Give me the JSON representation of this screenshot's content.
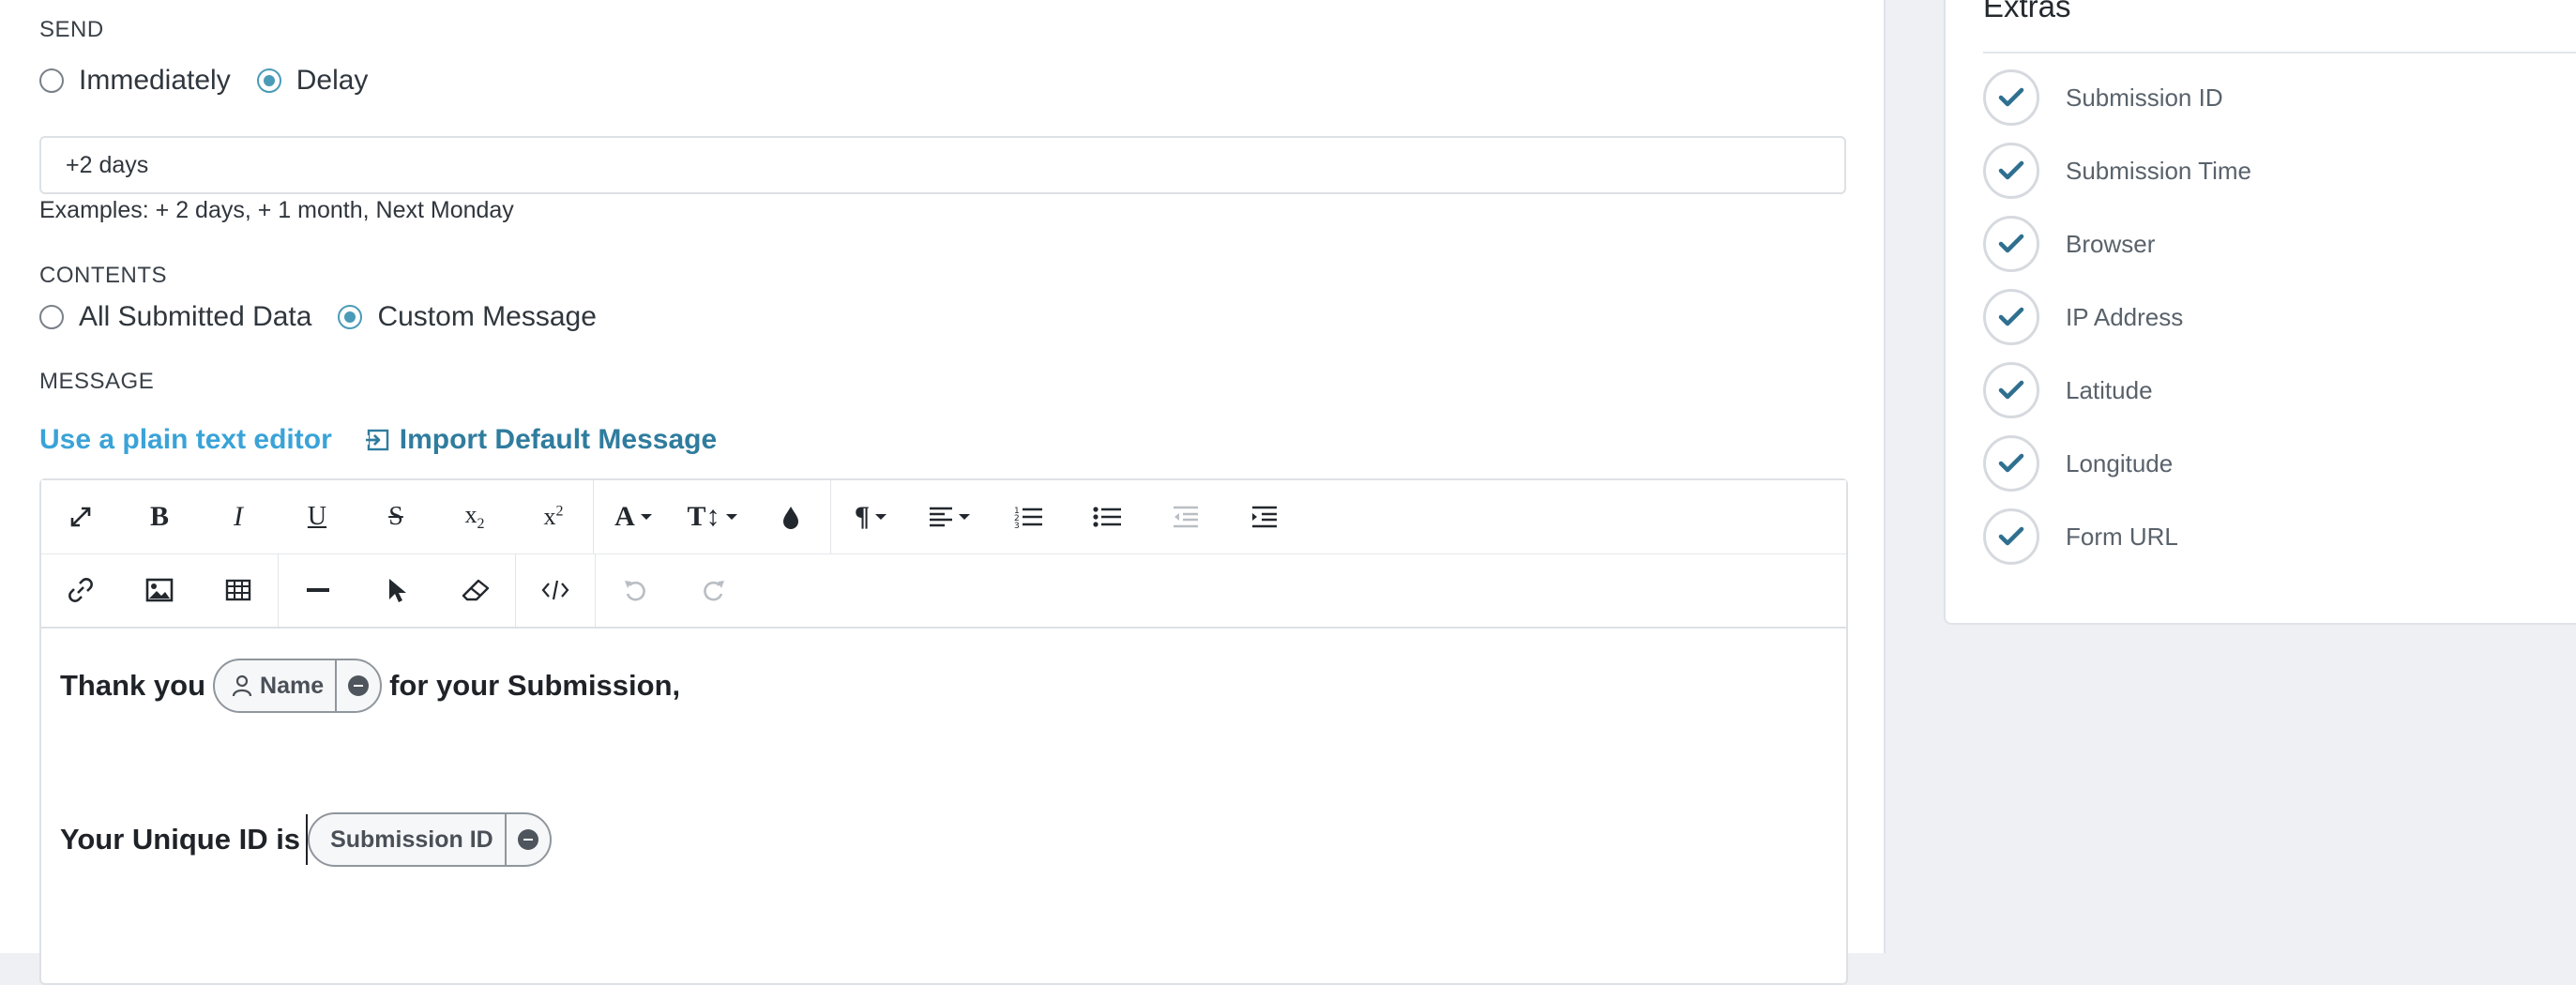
{
  "send": {
    "label": "SEND",
    "options": [
      "Immediately",
      "Delay"
    ],
    "selected": "Delay"
  },
  "delay": {
    "value": "+2 days",
    "hint": "Examples: + 2 days, + 1 month, Next Monday"
  },
  "contents": {
    "label": "CONTENTS",
    "options": [
      "All Submitted Data",
      "Custom Message"
    ],
    "selected": "Custom Message"
  },
  "message": {
    "label": "MESSAGE",
    "plain_editor_link": "Use a plain text editor",
    "import_link": "Import Default Message"
  },
  "toolbar": {
    "row1": [
      "fullscreen-icon",
      "bold-icon",
      "italic-icon",
      "underline-icon",
      "strikethrough-icon",
      "subscript-icon",
      "superscript-icon",
      "font-family-icon",
      "font-size-icon",
      "text-color-icon",
      "paragraph-format-icon",
      "align-icon",
      "ordered-list-icon",
      "unordered-list-icon",
      "outdent-icon",
      "indent-icon"
    ],
    "row2": [
      "insert-link-icon",
      "insert-image-icon",
      "insert-table-icon",
      "horizontal-line-icon",
      "select-all-icon",
      "clear-formatting-icon",
      "code-view-icon",
      "undo-icon",
      "redo-icon"
    ]
  },
  "editor_content": {
    "line1_before": "Thank you",
    "line1_tag": "Name",
    "line1_after": "for your Submission,",
    "line2_before": "Your Unique ID is",
    "line2_tag": "Submission ID"
  },
  "extras": {
    "title": "Extras",
    "items": [
      "Submission ID",
      "Submission Time",
      "Browser",
      "IP Address",
      "Latitude",
      "Longitude",
      "Form URL"
    ]
  },
  "colors": {
    "accent": "#4a9bb8",
    "link": "#3aa3d8",
    "check": "#2f6f8f"
  }
}
